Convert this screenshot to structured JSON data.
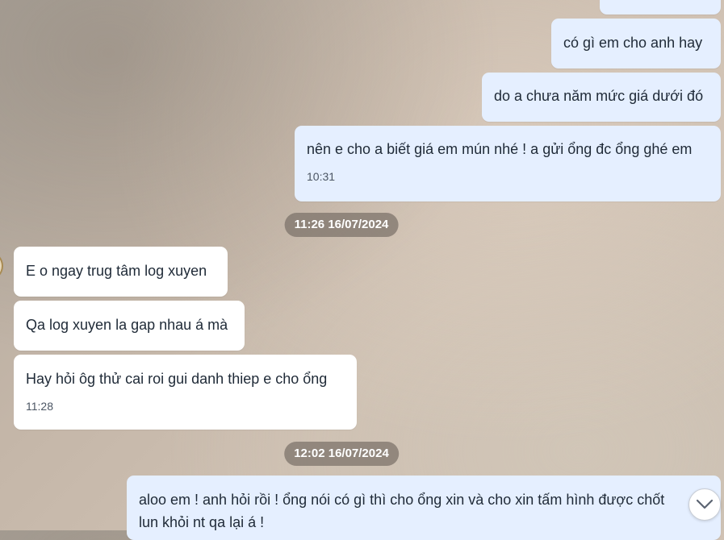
{
  "messages": [
    {
      "text": ""
    },
    {
      "text": "có gì em cho anh hay"
    },
    {
      "text": "do a chưa năm mức giá dưới đó"
    },
    {
      "text": "nên e cho a biết giá em mún nhé ! a gửi ổng đc ổng ghé em",
      "time": "10:31"
    },
    {
      "date": "11:26 16/07/2024"
    },
    {
      "text": "E o ngay trug tâm log xuyen"
    },
    {
      "text": "Qa log xuyen la gap nhau á mà"
    },
    {
      "text": "Hay hỏi ôg thử cai roi gui danh thiep e cho ổng",
      "time": "11:28"
    },
    {
      "date": "12:02 16/07/2024"
    },
    {
      "line1": "aloo em ! anh hỏi rồi ! ổng nói có gì thì cho ổng xin và cho xin tấm hình được chốt",
      "line2": "lun khỏi nt qa lại á !"
    }
  ],
  "scroll_button": {
    "icon": "chevron-down-icon"
  },
  "colors": {
    "outgoing_bubble": "#e5efff",
    "incoming_bubble": "#ffffff",
    "date_chip": "#7a7068",
    "text": "#1f2a37",
    "time": "#4b5563"
  }
}
